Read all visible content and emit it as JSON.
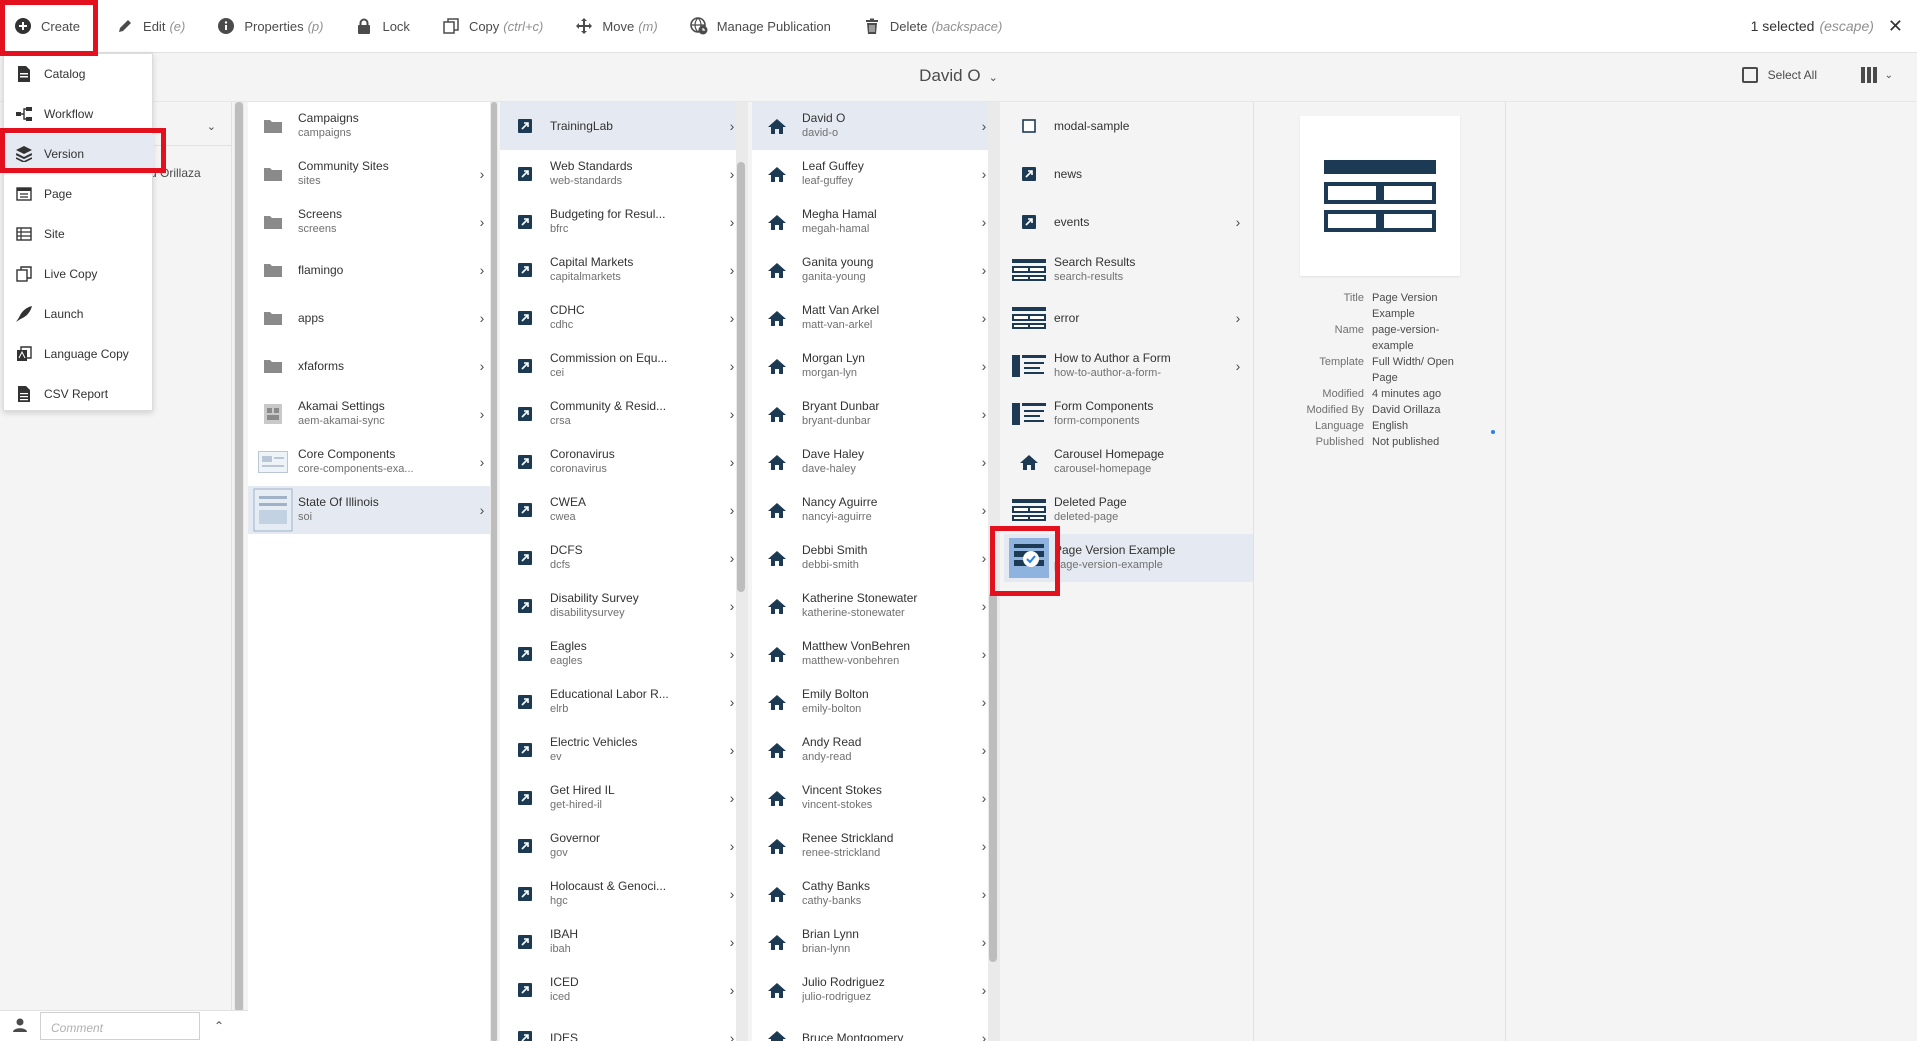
{
  "toolbar": {
    "create": "Create",
    "edit": "Edit",
    "edit_key": "(e)",
    "properties": "Properties",
    "properties_key": "(p)",
    "lock": "Lock",
    "copy": "Copy",
    "copy_key": "(ctrl+c)",
    "move": "Move",
    "move_key": "(m)",
    "manage_publication": "Manage Publication",
    "delete": "Delete",
    "delete_key": "(backspace)",
    "selection": "1 selected",
    "selection_key": "(escape)"
  },
  "header": {
    "title": "David O",
    "select_all": "Select All"
  },
  "create_menu": [
    {
      "label": "Catalog",
      "icon": "catalog-icon"
    },
    {
      "label": "Workflow",
      "icon": "workflow-icon"
    },
    {
      "label": "Version",
      "icon": "layers-icon"
    },
    {
      "label": "Page",
      "icon": "page-icon"
    },
    {
      "label": "Site",
      "icon": "site-icon"
    },
    {
      "label": "Live Copy",
      "icon": "live-copy-icon"
    },
    {
      "label": "Launch",
      "icon": "launch-icon"
    },
    {
      "label": "Language Copy",
      "icon": "language-copy-icon"
    },
    {
      "label": "CSV Report",
      "icon": "csv-report-icon"
    }
  ],
  "left_rail": {
    "partial_text": "d Orillaza",
    "comment_placeholder": "Comment"
  },
  "col1": [
    {
      "title": "Campaigns",
      "name": "campaigns"
    },
    {
      "title": "Community Sites",
      "name": "sites"
    },
    {
      "title": "Screens",
      "name": "screens"
    },
    {
      "title": "flamingo",
      "name": ""
    },
    {
      "title": "apps",
      "name": ""
    },
    {
      "title": "xfaforms",
      "name": ""
    },
    {
      "title": "Akamai Settings",
      "name": "aem-akamai-sync"
    },
    {
      "title": "Core Components",
      "name": "core-components-exa..."
    },
    {
      "title": "State Of Illinois",
      "name": "soi"
    }
  ],
  "col2": [
    {
      "title": "TrainingLab",
      "name": ""
    },
    {
      "title": "Web Standards",
      "name": "web-standards"
    },
    {
      "title": "Budgeting for Resul...",
      "name": "bfrc"
    },
    {
      "title": "Capital Markets",
      "name": "capitalmarkets"
    },
    {
      "title": "CDHC",
      "name": "cdhc"
    },
    {
      "title": "Commission on Equ...",
      "name": "cei"
    },
    {
      "title": "Community & Resid...",
      "name": "crsa"
    },
    {
      "title": "Coronavirus",
      "name": "coronavirus"
    },
    {
      "title": "CWEA",
      "name": "cwea"
    },
    {
      "title": "DCFS",
      "name": "dcfs"
    },
    {
      "title": "Disability Survey",
      "name": "disabilitysurvey"
    },
    {
      "title": "Eagles",
      "name": "eagles"
    },
    {
      "title": "Educational Labor R...",
      "name": "elrb"
    },
    {
      "title": "Electric Vehicles",
      "name": "ev"
    },
    {
      "title": "Get Hired IL",
      "name": "get-hired-il"
    },
    {
      "title": "Governor",
      "name": "gov"
    },
    {
      "title": "Holocaust & Genoci...",
      "name": "hgc"
    },
    {
      "title": "IBAH",
      "name": "ibah"
    },
    {
      "title": "ICED",
      "name": "iced"
    },
    {
      "title": "IDES",
      "name": ""
    }
  ],
  "col3": [
    {
      "title": "David O",
      "name": "david-o"
    },
    {
      "title": "Leaf Guffey",
      "name": "leaf-guffey"
    },
    {
      "title": "Megha Hamal",
      "name": "megah-hamal"
    },
    {
      "title": "Ganita young",
      "name": "ganita-young"
    },
    {
      "title": "Matt Van Arkel",
      "name": "matt-van-arkel"
    },
    {
      "title": "Morgan Lyn",
      "name": "morgan-lyn"
    },
    {
      "title": "Bryant Dunbar",
      "name": "bryant-dunbar"
    },
    {
      "title": "Dave Haley",
      "name": "dave-haley"
    },
    {
      "title": "Nancy Aguirre",
      "name": "nancyi-aguirre"
    },
    {
      "title": "Debbi Smith",
      "name": "debbi-smith"
    },
    {
      "title": "Katherine Stonewater",
      "name": "katherine-stonewater"
    },
    {
      "title": "Matthew VonBehren",
      "name": "matthew-vonbehren"
    },
    {
      "title": "Emily Bolton",
      "name": "emily-bolton"
    },
    {
      "title": "Andy Read",
      "name": "andy-read"
    },
    {
      "title": "Vincent Stokes",
      "name": "vincent-stokes"
    },
    {
      "title": "Renee Strickland",
      "name": "renee-strickland"
    },
    {
      "title": "Cathy Banks",
      "name": "cathy-banks"
    },
    {
      "title": "Brian Lynn",
      "name": "brian-lynn"
    },
    {
      "title": "Julio Rodriguez",
      "name": "julio-rodriguez"
    },
    {
      "title": "Bruce Montgomery",
      "name": ""
    }
  ],
  "col4": [
    {
      "title": "modal-sample",
      "name": ""
    },
    {
      "title": "news",
      "name": ""
    },
    {
      "title": "events",
      "name": ""
    },
    {
      "title": "Search Results",
      "name": "search-results"
    },
    {
      "title": "error",
      "name": ""
    },
    {
      "title": "How to Author a Form",
      "name": "how-to-author-a-form-"
    },
    {
      "title": "Form Components",
      "name": "form-components"
    },
    {
      "title": "Carousel Homepage",
      "name": "carousel-homepage"
    },
    {
      "title": "Deleted Page",
      "name": "deleted-page"
    },
    {
      "title": "Page Version Example",
      "name": "page-version-example"
    }
  ],
  "details": [
    {
      "key": "Title",
      "value": "Page Version Example"
    },
    {
      "key": "Name",
      "value": "page-version-example"
    },
    {
      "key": "Template",
      "value": "Full Width/ Open Page"
    },
    {
      "key": "Modified",
      "value": "4 minutes ago"
    },
    {
      "key": "Modified By",
      "value": "David Orillaza"
    },
    {
      "key": "Language",
      "value": "English"
    },
    {
      "key": "Published",
      "value": "Not published"
    }
  ],
  "colors": {
    "highlight": "#e3101d",
    "selected_row": "#e5e9f1",
    "icon_dark": "#1d3a55",
    "accent": "#2680eb"
  }
}
